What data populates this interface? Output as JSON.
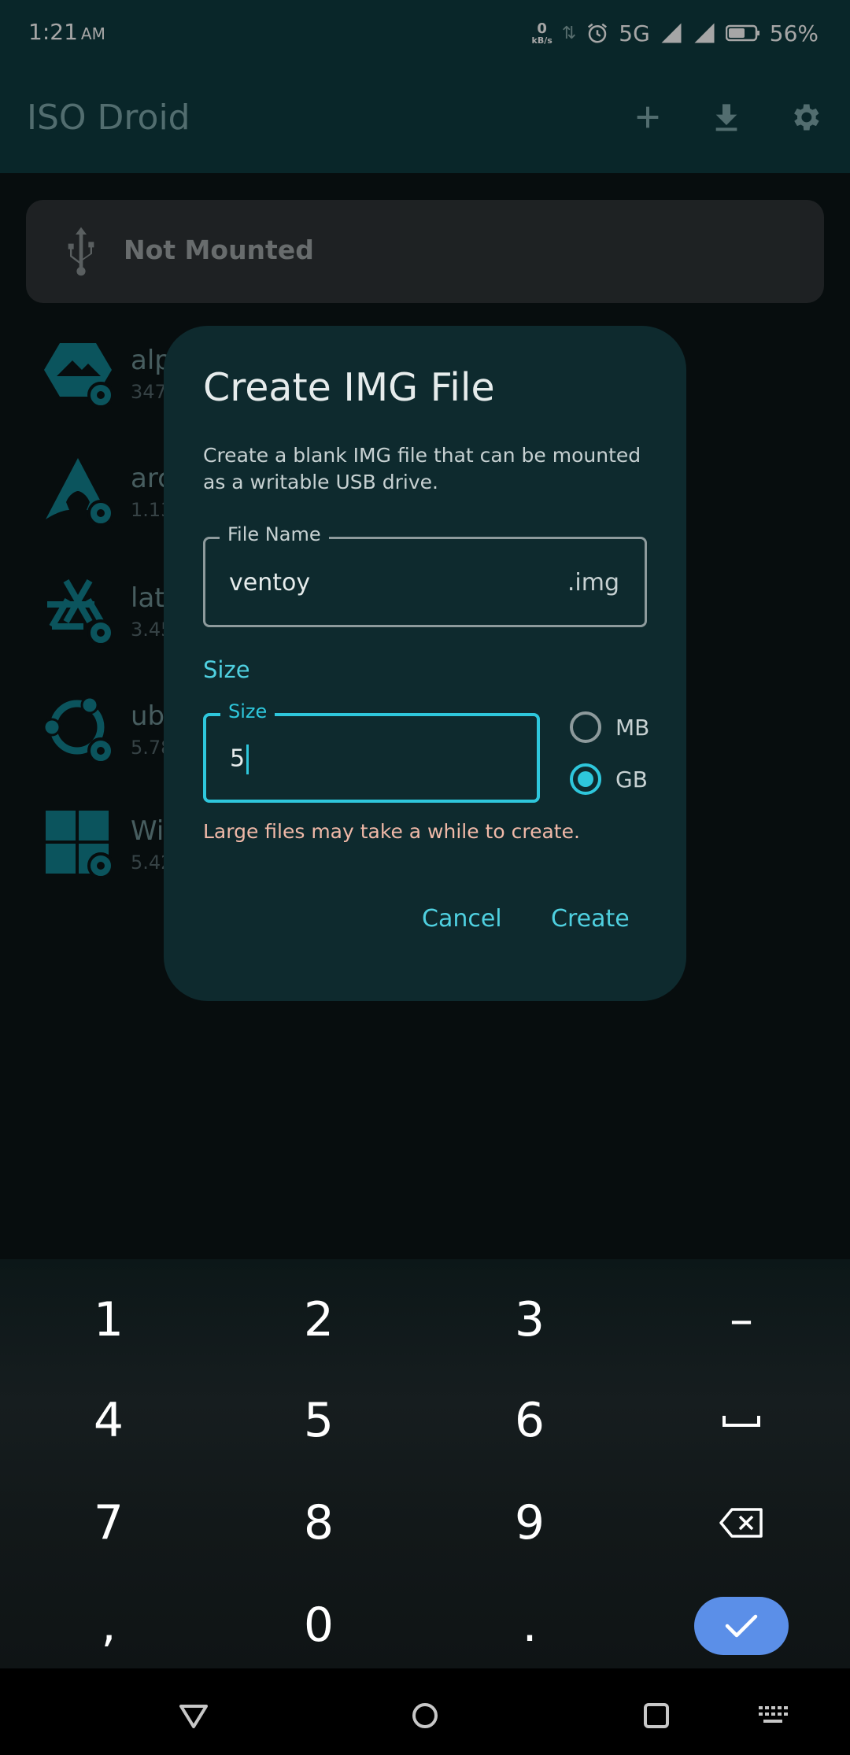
{
  "status_bar": {
    "time": "1:21",
    "ampm": "AM",
    "net_speed_value": "0",
    "net_speed_unit": "kB/s",
    "network": "5G",
    "battery": "56%"
  },
  "app_bar": {
    "title": "ISO Droid",
    "actions": [
      "add-icon",
      "download-icon",
      "settings-icon"
    ]
  },
  "mount_card": {
    "label": "Not Mounted"
  },
  "iso_list": [
    {
      "name": "alp",
      "size": "347.",
      "icon": "alpine-icon"
    },
    {
      "name": "arc",
      "size": "1.13",
      "icon": "arch-icon"
    },
    {
      "name": "lat",
      "size": "3.45",
      "icon": "nixos-icon"
    },
    {
      "name": "ub",
      "size": "5.78",
      "icon": "ubuntu-icon"
    },
    {
      "name": "Wi",
      "size": "5.42",
      "icon": "windows-icon"
    }
  ],
  "dialog": {
    "title": "Create IMG File",
    "description": "Create a blank IMG file that can be mounted as a writable USB drive.",
    "file_name_label": "File Name",
    "file_name_value": "ventoy",
    "file_name_suffix": ".img",
    "size_heading": "Size",
    "size_label": "Size",
    "size_value": "5",
    "unit_options": [
      "MB",
      "GB"
    ],
    "unit_selected": "GB",
    "warning": "Large files may take a while to create.",
    "cancel_label": "Cancel",
    "create_label": "Create"
  },
  "keyboard": {
    "keys": [
      [
        "1",
        "2",
        "3",
        "–"
      ],
      [
        "4",
        "5",
        "6",
        "space-icon"
      ],
      [
        "7",
        "8",
        "9",
        "backspace-icon"
      ],
      [
        ",",
        "0",
        ".",
        "done-icon"
      ]
    ],
    "accent": "#5b8fe8"
  },
  "nav_bar": {
    "buttons": [
      "back-icon",
      "home-icon",
      "recents-icon",
      "keyboard-switch-icon"
    ]
  },
  "colors": {
    "accent": "#2ec7dc",
    "app_bar": "#0e3b3f",
    "dialog_bg": "#0e2a2e",
    "warning": "#f0b9a8"
  }
}
